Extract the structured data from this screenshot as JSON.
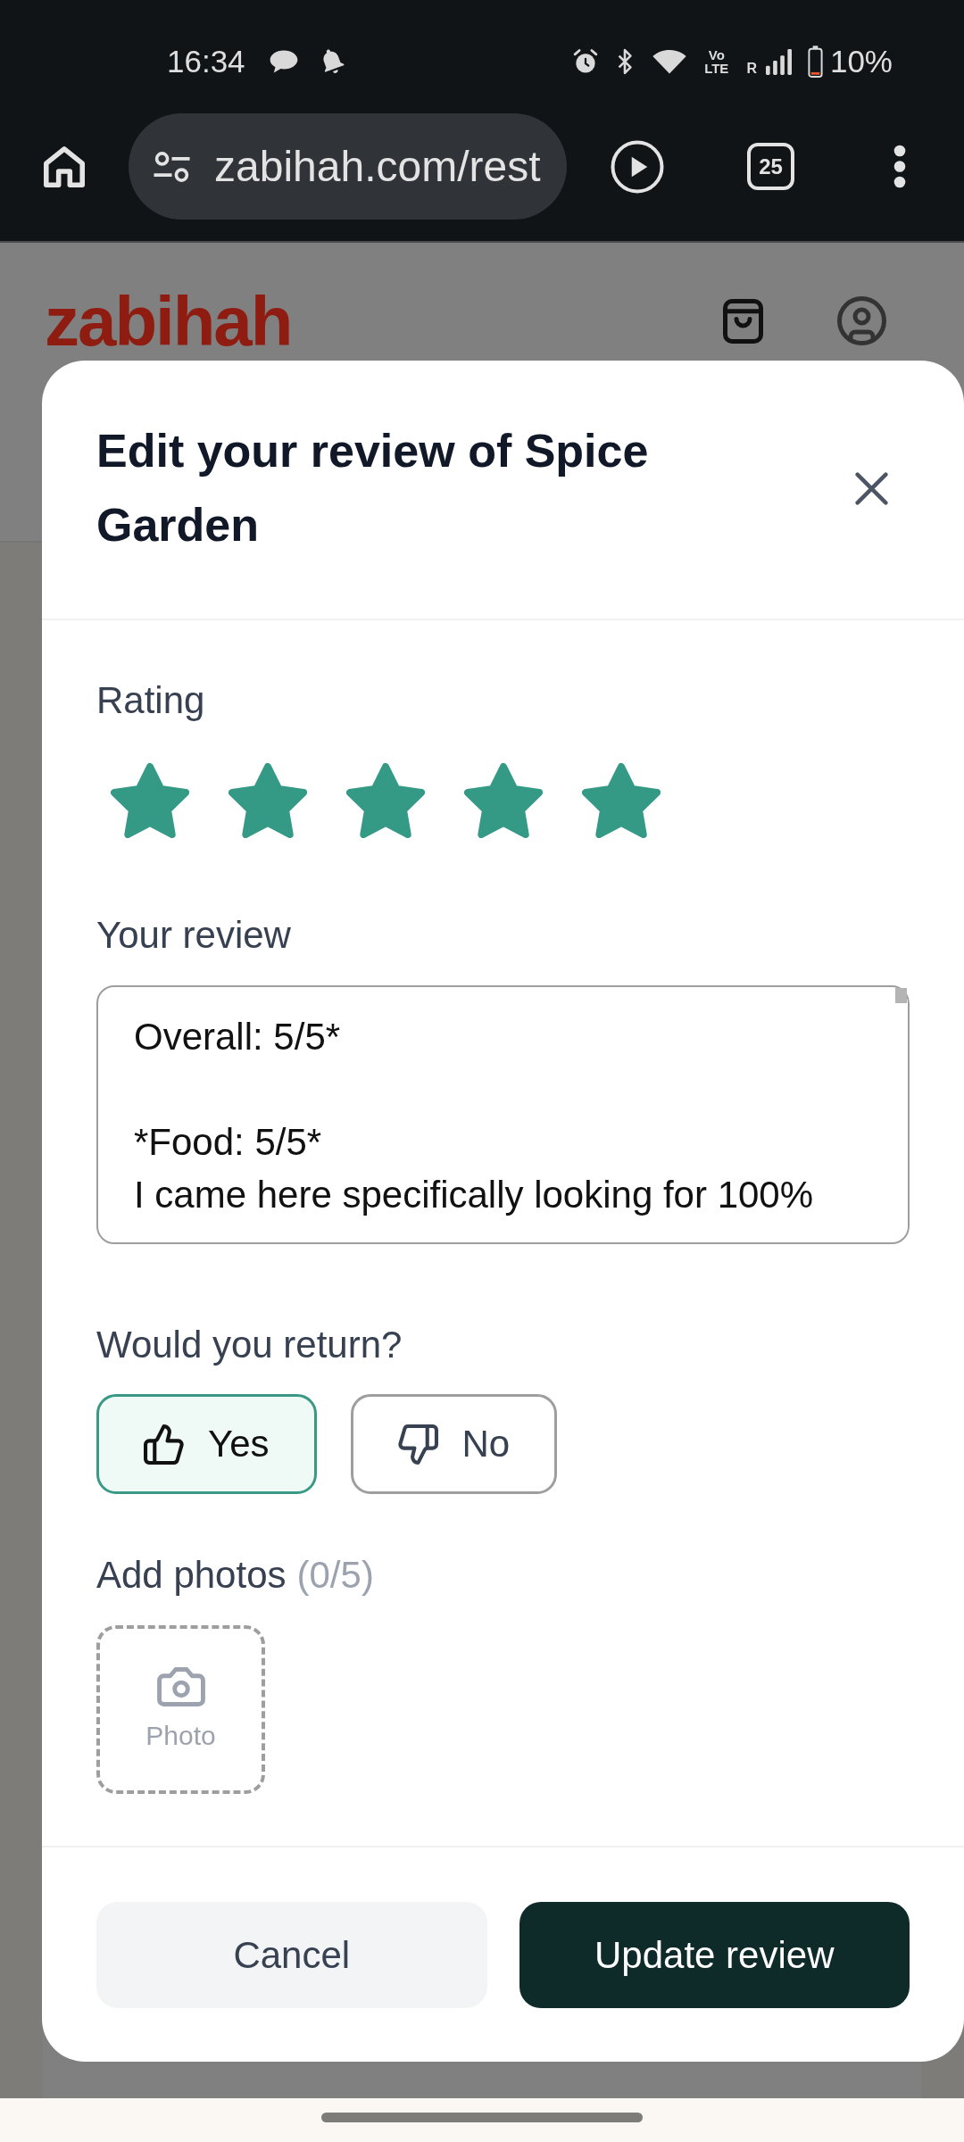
{
  "status_bar": {
    "time": "16:34",
    "network_top": "Vo",
    "network_bottom": "LTE",
    "roaming": "R",
    "battery": "10%"
  },
  "browser": {
    "url": "zabihah.com/rest",
    "tab_count": "25"
  },
  "site_header": {
    "logo": "zabihah"
  },
  "dialog": {
    "title": "Edit your review of Spice Garden",
    "rating": {
      "label": "Rating",
      "stars": 5
    },
    "review": {
      "label": "Your review",
      "value": "Overall: 5/5*\n\n*Food: 5/5*\nI came here specifically looking for 100%"
    },
    "would_return": {
      "label": "Would you return?",
      "options": [
        {
          "label": "Yes",
          "kind": "thumbs_up",
          "selected": true
        },
        {
          "label": "No",
          "kind": "thumbs_down",
          "selected": false
        }
      ]
    },
    "photos": {
      "label": "Add photos",
      "count": "(0/5)",
      "add_button": {
        "label": "Photo"
      }
    },
    "buttons": [
      {
        "label": "Cancel",
        "kind": "secondary"
      },
      {
        "label": "Update review",
        "kind": "primary"
      }
    ]
  }
}
